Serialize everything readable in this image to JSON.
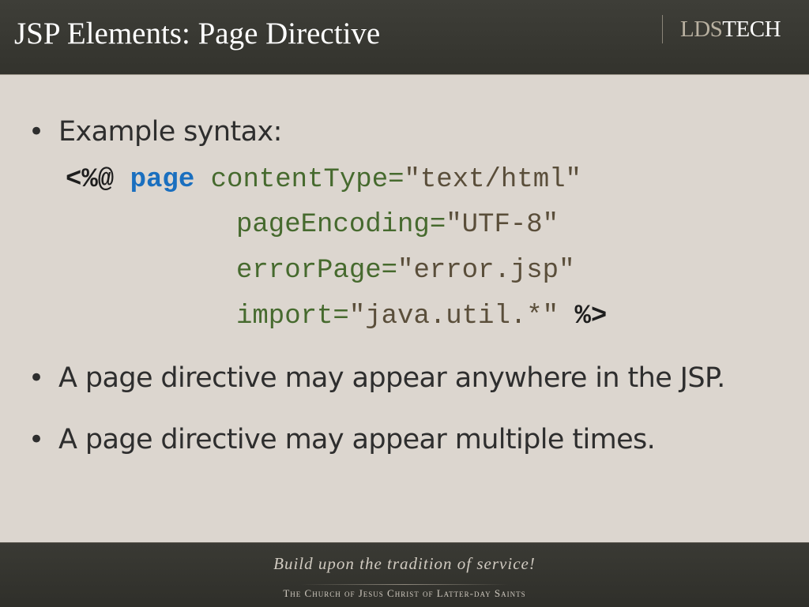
{
  "header": {
    "title": "JSP Elements: Page Directive",
    "logo": {
      "part1": "LDS",
      "part2": "TECH"
    }
  },
  "bullets": [
    {
      "text": "Example syntax:"
    },
    {
      "text": "A page directive may appear anywhere in the JSP."
    },
    {
      "text": "A page directive may appear multiple times."
    }
  ],
  "code": {
    "open": "<%@",
    "keyword": "page",
    "lines": [
      {
        "attr": "contentType",
        "eq": "=",
        "value": "\"text/html\""
      },
      {
        "attr": "pageEncoding",
        "eq": "=",
        "value": "\"UTF-8\""
      },
      {
        "attr": "errorPage",
        "eq": "=",
        "value": "\"error.jsp\""
      },
      {
        "attr": "import",
        "eq": "=",
        "value": "\"java.util.*\""
      }
    ],
    "close": "%>"
  },
  "footer": {
    "tagline": "Build upon the tradition of service!",
    "church": "The Church of Jesus Christ of Latter-day Saints"
  }
}
